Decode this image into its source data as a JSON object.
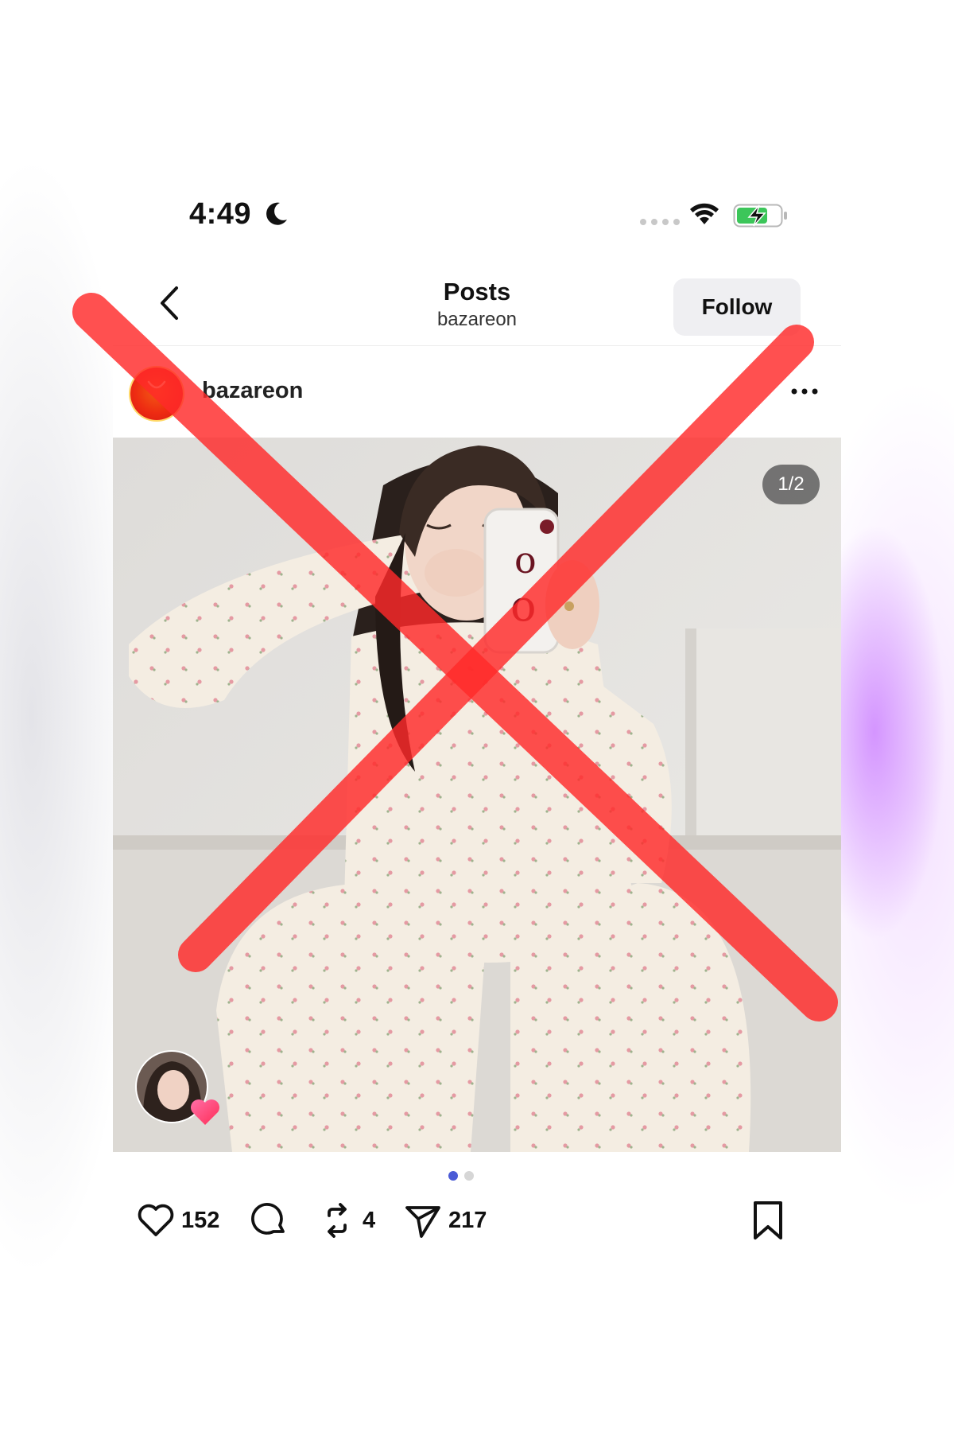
{
  "status_bar": {
    "time": "4:49",
    "icons": [
      "moon-icon",
      "signal-icon",
      "wifi-icon",
      "battery-charging-icon"
    ]
  },
  "nav": {
    "title": "Posts",
    "subtitle": "bazareon",
    "follow_label": "Follow",
    "back_icon": "chevron-left-icon"
  },
  "post": {
    "username": "bazareon",
    "menu_icon": "more-horizontal-icon",
    "page_counter": "1/2",
    "carousel": {
      "total_pages": 2,
      "current_page": 1
    }
  },
  "actions": {
    "likes": "152",
    "reposts": "4",
    "shares": "217",
    "icons": [
      "heart-icon",
      "comment-icon",
      "repost-icon",
      "share-icon",
      "bookmark-icon"
    ]
  },
  "overlay": {
    "mark": "red-x-cross",
    "color": "#ff2a2a"
  },
  "colors": {
    "accent_dot": "#4b5bd6",
    "follow_bg": "#efeff2",
    "avatar_red": "#ee2c12"
  }
}
